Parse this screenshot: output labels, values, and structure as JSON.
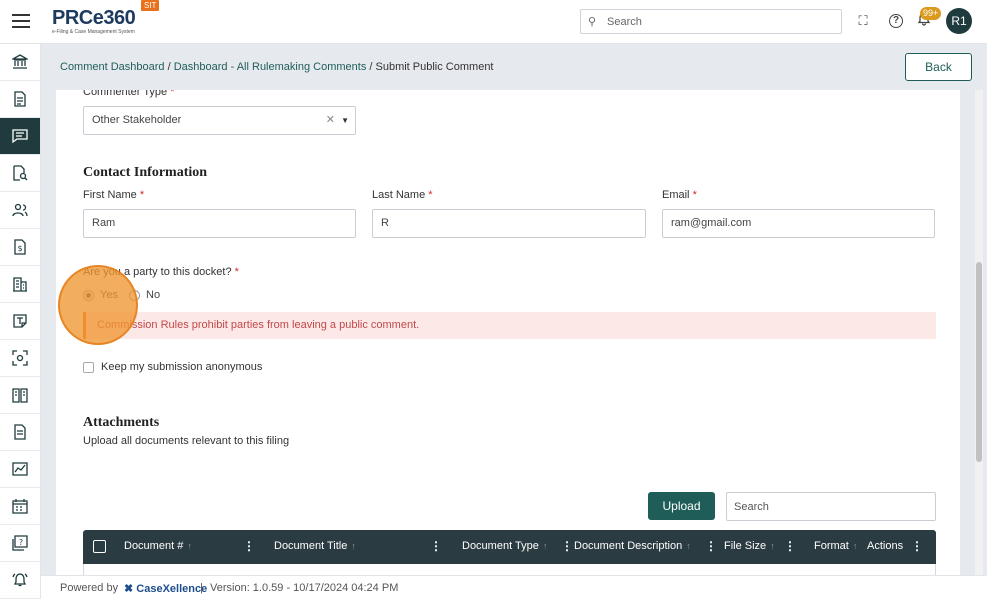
{
  "app": {
    "logo_text": "PRCe360",
    "logo_subtitle": "e-Filing & Case Management System",
    "env_badge": "SIT"
  },
  "header": {
    "search_placeholder": "Search",
    "notifications_count": "99+",
    "avatar_initials": "R1"
  },
  "sidebar": {
    "items": [
      {
        "icon": "bank-icon"
      },
      {
        "icon": "document-icon"
      },
      {
        "icon": "comment-icon",
        "active": true
      },
      {
        "icon": "document-search-icon"
      },
      {
        "icon": "users-icon"
      },
      {
        "icon": "dollar-document-icon"
      },
      {
        "icon": "building-icon"
      },
      {
        "icon": "template-icon"
      },
      {
        "icon": "scan-icon"
      },
      {
        "icon": "book-icon"
      },
      {
        "icon": "file-icon"
      },
      {
        "icon": "chart-icon"
      },
      {
        "icon": "calendar-icon"
      },
      {
        "icon": "help-doc-icon"
      },
      {
        "icon": "bell-alert-icon"
      }
    ]
  },
  "breadcrumb": {
    "items": [
      "Comment Dashboard",
      "Dashboard - All Rulemaking Comments"
    ],
    "separator": " / ",
    "current": "Submit Public Comment"
  },
  "back_label": "Back",
  "form": {
    "commenter_type_label": "Commenter Type",
    "commenter_type_value": "Other Stakeholder",
    "contact_heading": "Contact Information",
    "first_name_label": "First Name",
    "first_name_value": "Ram",
    "last_name_label": "Last Name",
    "last_name_value": "R",
    "email_label": "Email",
    "email_value": "ram@gmail.com",
    "party_question": "Are you a party to this docket?",
    "yes_label": "Yes",
    "no_label": "No",
    "party_selected": "Yes",
    "alert_text": "Commission Rules prohibit parties from leaving a public comment.",
    "anonymous_label": "Keep my submission anonymous",
    "required_mark": "*"
  },
  "attachments": {
    "heading": "Attachments",
    "subtext": "Upload all documents relevant to this filing",
    "upload_label": "Upload",
    "search_placeholder": "Search",
    "columns": [
      "Document #",
      "Document Title",
      "Document Type",
      "Document Description",
      "File Size",
      "Format",
      "Actions"
    ]
  },
  "footer": {
    "powered_by": "Powered by",
    "brand": "CaseXellence",
    "separator": "|",
    "version": "Version: 1.0.59 - 10/17/2024 04:24 PM"
  },
  "colors": {
    "primary": "#1f5e58",
    "sidebar_active": "#1f3b3e",
    "alert_bg": "#fde8e8",
    "alert_text": "#c24848",
    "accent": "#e8711d"
  }
}
